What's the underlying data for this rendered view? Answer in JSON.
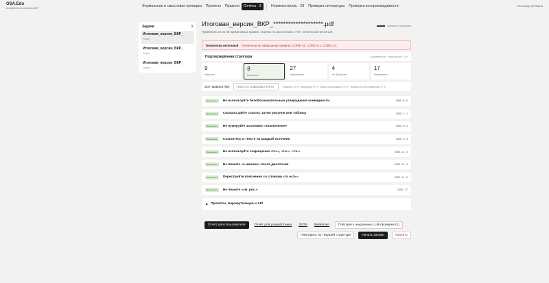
{
  "brand": {
    "title": "OSA.Edu",
    "subtitle": "Академическая проверка ВКР"
  },
  "nav": [
    {
      "label": "Формальная и смысловая проверка",
      "active": false
    },
    {
      "label": "Промпты",
      "active": false
    },
    {
      "label": "Правила",
      "active": false
    },
    {
      "label": "Отчёты · 3",
      "active": true
    },
    {
      "label": "Нормоконтроль · 28",
      "active": false
    },
    {
      "label": "Проверка литературы",
      "active": false
    },
    {
      "label": "Проверка воспроизводимости",
      "active": false
    }
  ],
  "user": "Олександр Зав.Фирма",
  "sidebar": {
    "title": "Задачи",
    "count": "3",
    "tasks": [
      {
        "name": "Итоговая_версия_ВКР_",
        "status": "Готово"
      },
      {
        "name": "Итоговая_версия_ВКР_",
        "status": "Готово"
      },
      {
        "name": "Итоговая_версия_ВКР_",
        "status": "Готово"
      }
    ]
  },
  "main": {
    "title": "Итоговая_версия_ВКР_********************.pdf",
    "subtitle": "Проверено 17 из 48 применимых правил. Оценка не рассчитана: отчёт технически неполный.",
    "score_label": "оценка не рассчитана",
    "alert": {
      "title": "Технически неполный",
      "text": "Технически не завершены правила: CORE-14, CORE-2-1, CORE-2-2."
    },
    "section": {
      "title": "Подтверждённая структура",
      "meta": "К уровнемным · треки начало 1 LH"
    },
    "stats": [
      {
        "num": "9",
        "label": "Нарушено"
      },
      {
        "num": "8",
        "label": "Выполнено"
      },
      {
        "num": "27",
        "label": "Неприменимо"
      },
      {
        "num": "4",
        "label": "Не обработано"
      },
      {
        "num": "17",
        "label": "Непроверено"
      }
    ],
    "filter": {
      "all_label": "Все правила (65)",
      "placeholder": "Поиск по правилам отчёта",
      "stats": "Правила: 32 % · кандидаты 37 % · запуск обоснования: 73 % · правила по обоснованиям: 47 %"
    },
    "rules": [
      {
        "badge": "Выполнено",
        "text": "Не используйте безобосновательные утверждения очевидности",
        "code": "CORE-6-6"
      },
      {
        "badge": "Выполнено",
        "text": "Сначала дайте ссылку, затем рисунок или таблицу",
        "code": "CORE-7-1"
      },
      {
        "badge": "Выполнено",
        "text": "Не нумеруйте заголовок «Заключение»",
        "code": "CORE-8-3"
      },
      {
        "badge": "Выполнено",
        "text": "Сошлитесь в тексте на каждый источник",
        "code": "CORE-9-4"
      },
      {
        "badge": "Выполнено",
        "text": "Не используйте сокращения «т.н.», «т.к.», «т.ч.»",
        "code": "CORE-11-3"
      },
      {
        "badge": "Выполнено",
        "text": "Не пишите «а именно» после двоеточия",
        "code": "CORE-11-4"
      },
      {
        "badge": "Выполнено",
        "text": "Перестройте пояснения со словами «то есть»",
        "code": "CORE-11-5"
      },
      {
        "badge": "Выполнено",
        "text": "Не пишите «см. рис.»",
        "code": "CORE-17"
      }
    ],
    "collapse_label": "Промпты, маршрутизация и API"
  },
  "actions": {
    "report_user": "Отчёт для пользователя",
    "report_dev": "Отчёт для разработчика",
    "json": "JSON",
    "markdown": "Markdown",
    "retry_llm": "Повторить неудачные LLM-проверки (1)",
    "retry_structure": "Повторить по текущей структуре",
    "restart": "Начать заново",
    "delete": "Удалить"
  }
}
